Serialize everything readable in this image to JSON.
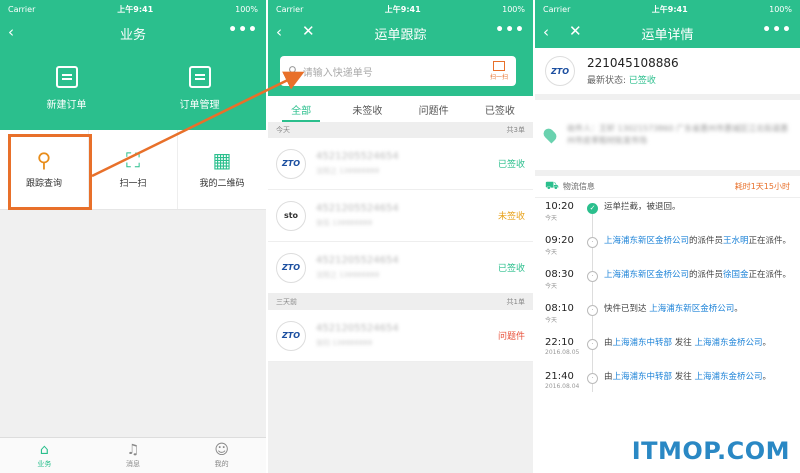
{
  "status_bar": {
    "carrier": "Carrier",
    "time": "上午9:41",
    "battery": "100%"
  },
  "screen1": {
    "title": "业务",
    "more": "•••",
    "actions": [
      {
        "label": "新建订单",
        "icon": "new-order-icon"
      },
      {
        "label": "订单管理",
        "icon": "order-manage-icon"
      }
    ],
    "grid": [
      {
        "label": "跟踪查询",
        "icon": "search-icon"
      },
      {
        "label": "扫一扫",
        "icon": "scan-icon"
      },
      {
        "label": "我的二维码",
        "icon": "qr-code-icon"
      }
    ],
    "tabbar": [
      {
        "label": "业务",
        "icon": "home-icon",
        "active": true
      },
      {
        "label": "消息",
        "icon": "bell-icon",
        "active": false
      },
      {
        "label": "我的",
        "icon": "user-icon",
        "active": false
      }
    ]
  },
  "screen2": {
    "title": "运单跟踪",
    "search_placeholder": "请输入快递单号",
    "scan_label": "扫一扫",
    "tabs": [
      "全部",
      "未签收",
      "问题件",
      "已签收"
    ],
    "groups": [
      {
        "label": "今天",
        "count": "共3单",
        "items": [
          {
            "carrier": "ZTO",
            "number": "4521205524654",
            "sub": "沈阳之 138888888",
            "status": "已签收",
            "status_color": "#2bbf8d"
          },
          {
            "carrier": "sto",
            "number": "4521205524654",
            "sub": "张伍 138888888",
            "status": "未签收",
            "status_color": "#e8a21b"
          },
          {
            "carrier": "ZTO",
            "number": "4521205524654",
            "sub": "沈阳之 138888888",
            "status": "已签收",
            "status_color": "#2bbf8d"
          }
        ]
      },
      {
        "label": "三天前",
        "count": "共1单",
        "items": [
          {
            "carrier": "ZTO",
            "number": "4521205524654",
            "sub": "张钧 138888888",
            "status": "问题件",
            "status_color": "#e8503a"
          }
        ]
      }
    ]
  },
  "screen3": {
    "title": "运单详情",
    "carrier": "ZTO",
    "waybill_no": "221045108886",
    "latest_state_label": "最新状态:",
    "latest_state": "已签收",
    "address": "收件人：王轩   13021573860  广东省惠州市惠城区江北街道惠州市皮革鞋材批发市场",
    "log_title": "物流信息",
    "duration": "耗时1天15小时",
    "entries": [
      {
        "time": "10:20",
        "date": "今天",
        "done": true,
        "parts": [
          "运单拦截，被退回。"
        ]
      },
      {
        "time": "09:20",
        "date": "今天",
        "done": false,
        "parts": [
          "上海浦东新区金桥公司",
          "的派件员",
          "王水明",
          "正在派件。"
        ]
      },
      {
        "time": "08:30",
        "date": "今天",
        "done": false,
        "parts": [
          "上海浦东新区金桥公司",
          "的派件员",
          "徐国金",
          "正在派件。"
        ]
      },
      {
        "time": "08:10",
        "date": "今天",
        "done": false,
        "parts": [
          "快件已到达 ",
          "上海浦东新区金桥公司",
          "。",
          ""
        ]
      },
      {
        "time": "22:10",
        "date": "2016.08.05",
        "done": false,
        "parts": [
          "由",
          "上海浦东中转部",
          " 发往 ",
          "上海浦东金桥公司",
          "。"
        ]
      },
      {
        "time": "21:40",
        "date": "2016.08.04",
        "done": false,
        "parts": [
          "由",
          "上海浦东中转部",
          " 发往 ",
          "上海浦东金桥公司",
          "。"
        ]
      }
    ]
  },
  "watermark": "ITMOP.COM",
  "colors": {
    "brand": "#2bbf8d",
    "highlight": "#e8702a",
    "link": "#1f84d8"
  }
}
